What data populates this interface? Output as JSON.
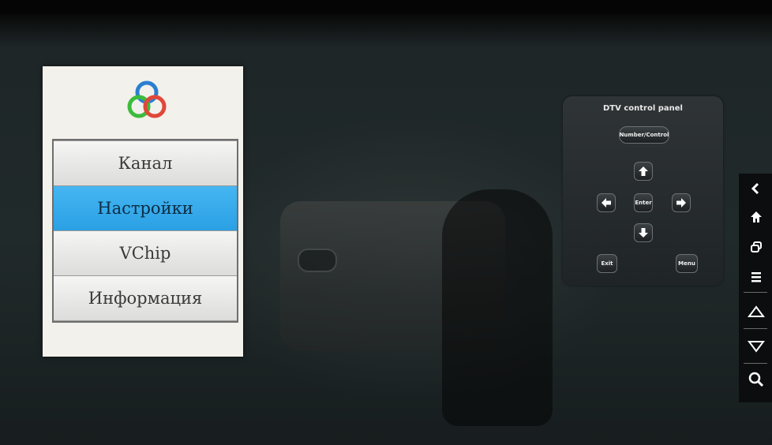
{
  "menu": {
    "items": [
      {
        "label": "Канал",
        "selected": false
      },
      {
        "label": "Настройки",
        "selected": true
      },
      {
        "label": "VChip",
        "selected": false
      },
      {
        "label": "Информация",
        "selected": false
      }
    ],
    "selected_color": "#2fa7ea"
  },
  "dtv_panel": {
    "title": "DTV control panel",
    "number_control_label": "Number/Control",
    "enter_label": "Enter",
    "exit_label": "Exit",
    "menu_label": "Menu",
    "arrows": [
      "up-arrow-icon",
      "left-arrow-icon",
      "right-arrow-icon",
      "down-arrow-icon"
    ]
  },
  "nav_bar": {
    "icons": [
      "back-icon",
      "home-icon",
      "recent-apps-icon",
      "menu-icon",
      "volume-up-icon",
      "volume-down-icon",
      "search-icon"
    ]
  }
}
